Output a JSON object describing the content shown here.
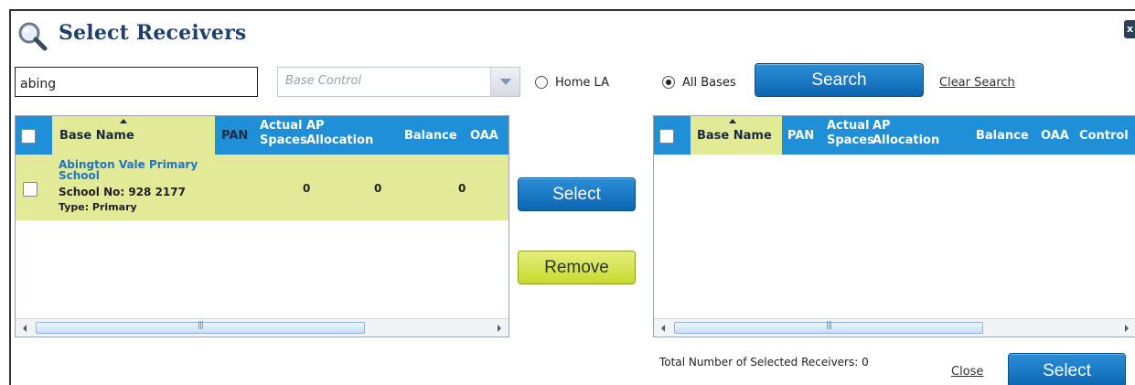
{
  "dialog": {
    "title": "Select Receivers",
    "close_label": "x"
  },
  "search": {
    "value": "abing",
    "base_control_placeholder": "Base Control",
    "radio_home_la": "Home LA",
    "radio_all_bases": "All Bases",
    "selected_radio": "All Bases",
    "search_button": "Search",
    "clear_link": "Clear Search"
  },
  "left_grid": {
    "columns": [
      "Base Name",
      "PAN",
      "Actual Spaces",
      "AP Allocation",
      "Balance",
      "OAA"
    ],
    "col_actual_1": "Actual",
    "col_actual_2": "Spaces",
    "col_ap_1": "AP",
    "col_ap_2": "Allocation",
    "sorted_column": "Base Name",
    "rows": [
      {
        "name_line1": "Abington Vale Primary",
        "name_line2": "School",
        "school_no": "School No: 928 2177",
        "type": "Type: Primary",
        "actual_spaces": "0",
        "ap_allocation": "0",
        "balance": "0"
      }
    ]
  },
  "middle": {
    "select_button": "Select",
    "remove_button": "Remove"
  },
  "right_grid": {
    "columns": [
      "Base Name",
      "PAN",
      "Actual Spaces",
      "AP Allocation",
      "Balance",
      "OAA",
      "Control"
    ],
    "col_actual_1": "Actual",
    "col_actual_2": "Spaces",
    "col_ap_1": "AP",
    "col_ap_2": "Allocation",
    "sorted_column": "Base Name",
    "rows": []
  },
  "footer": {
    "total_label": "Total Number of Selected Receivers: 0",
    "close_link": "Close",
    "select_button": "Select"
  },
  "colors": {
    "header_blue": "#1f8fd8",
    "highlight_green": "#e2ea98",
    "title_navy": "#1f3f6e",
    "link_blue": "#1f74c9"
  }
}
